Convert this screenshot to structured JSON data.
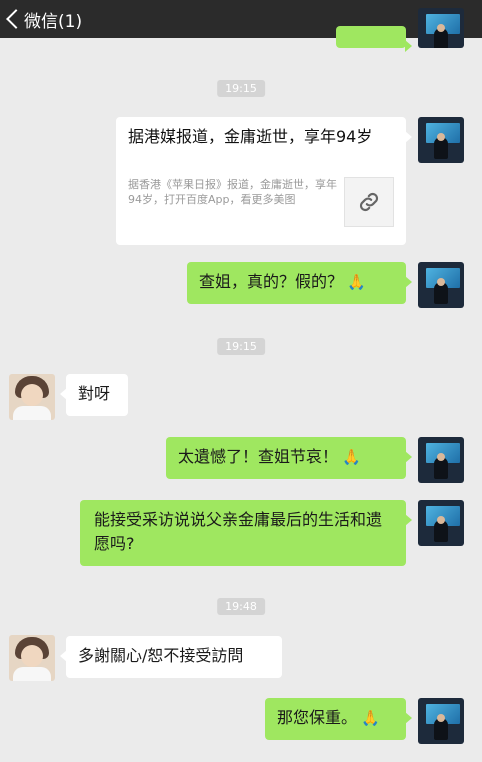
{
  "header": {
    "back_label": "微信(1)",
    "more_label": "···"
  },
  "timestamps": [
    "19:15",
    "19:15",
    "19:48"
  ],
  "messages": {
    "link_card": {
      "title": "据港媒报道，金庸逝世，享年94岁",
      "description": "据香港《苹果日报》报道，金庸逝世，享年94岁，打开百度App，看更多美图",
      "thumb_icon": "link-icon"
    },
    "m1": {
      "text": "查姐，真的？假的？",
      "emoji": "🙏"
    },
    "m2": {
      "text": "對呀"
    },
    "m3": {
      "text": "太遺憾了！查姐节哀！",
      "emoji": "🙏"
    },
    "m4": {
      "text": "能接受采访说说父亲金庸最后的生活和遗愿吗?"
    },
    "m5": {
      "text": "多謝關心/恕不接受訪問"
    },
    "m6": {
      "text": "那您保重。",
      "emoji": "🙏"
    }
  },
  "colors": {
    "header": "#2b2b2b",
    "background": "#ebebeb",
    "sent_bubble": "#9fe760",
    "received_bubble": "#ffffff"
  }
}
